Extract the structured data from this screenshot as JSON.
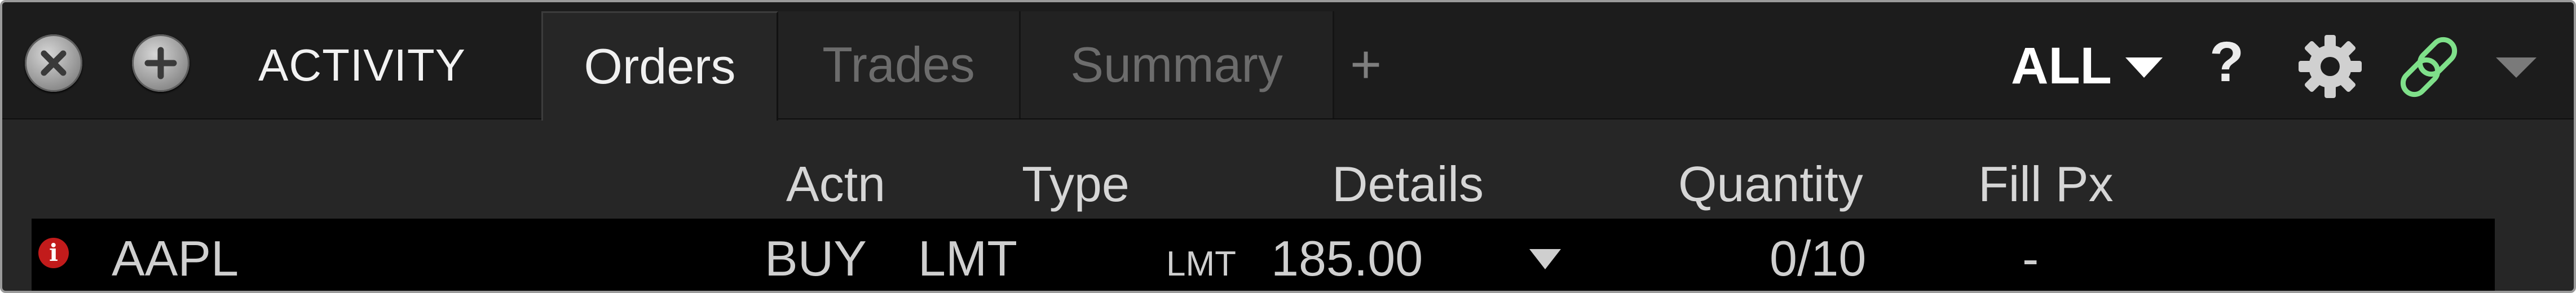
{
  "panel": {
    "title": "ACTIVITY",
    "close_icon": "close-icon",
    "add_icon": "add-icon"
  },
  "tabs": [
    {
      "label": "Orders",
      "active": true
    },
    {
      "label": "Trades",
      "active": false
    },
    {
      "label": "Summary",
      "active": false
    }
  ],
  "tab_add_label": "+",
  "toolbar": {
    "filter_label": "ALL",
    "help_label": "?",
    "icons": [
      "chevron-down-icon",
      "help-icon",
      "gear-icon",
      "link-icon",
      "chevron-down-icon"
    ],
    "link_color": "#7fe08a"
  },
  "columns": {
    "actn": "Actn",
    "type": "Type",
    "details": "Details",
    "quantity": "Quantity",
    "fill_px": "Fill Px"
  },
  "orders": [
    {
      "alert_icon": "info-alert-icon",
      "alert_glyph": "i",
      "symbol": "AAPL",
      "actn": "BUY",
      "type": "LMT",
      "details_type": "LMT",
      "details_price": "185.00",
      "quantity": "0/10",
      "fill_px": "-"
    }
  ],
  "colors": {
    "background": "#262626",
    "tabbar": "#1c1c1c",
    "row": "#000000",
    "alert": "#c21b1b"
  }
}
